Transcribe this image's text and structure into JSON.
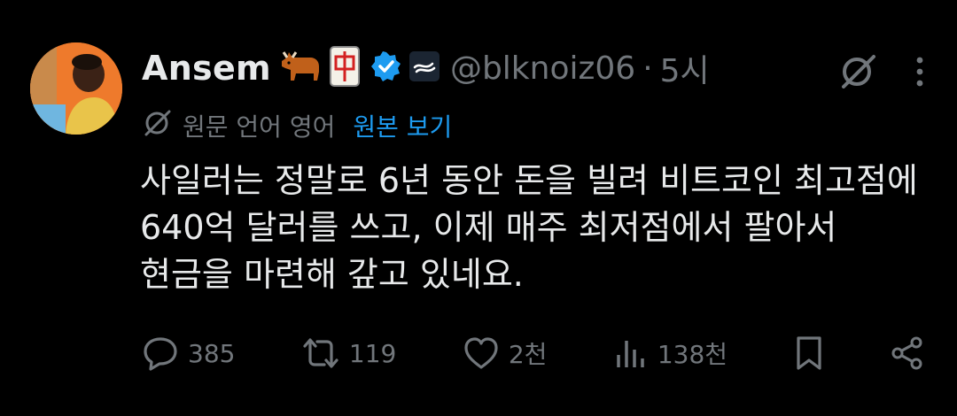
{
  "tweet": {
    "author": {
      "display_name": "Ansem",
      "emoji_1": "ox",
      "emoji_2": "mahjong-red-dragon",
      "handle": "@blknoiz06",
      "time": "5시"
    },
    "translation": {
      "label": "원문 언어 영어",
      "view_original": "원본 보기"
    },
    "text_lines": [
      "사일러는 정말로 6년 동안 돈을 빌려 비트코인 최고점에",
      "640억 달러를 쓰고, 이제 매주 최저점에서 팔아서",
      "현금을 마련해 갚고 있네요."
    ],
    "stats": {
      "replies": "385",
      "reposts": "119",
      "likes": "2천",
      "views": "138천"
    }
  },
  "colors": {
    "background": "#000000",
    "text": "#e7e9ea",
    "muted": "#71767b",
    "accent": "#1d9bf0"
  }
}
